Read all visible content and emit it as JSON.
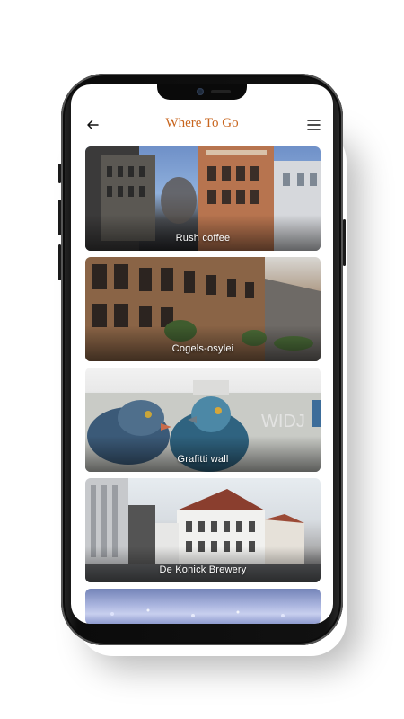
{
  "header": {
    "title": "Where To Go",
    "back_icon": "arrow-left-icon",
    "menu_icon": "hamburger-menu-icon"
  },
  "places": [
    {
      "name": "Rush coffee"
    },
    {
      "name": "Cogels-osylei"
    },
    {
      "name": "Grafitti wall"
    },
    {
      "name": "De Konick Brewery"
    },
    {
      "name": ""
    }
  ],
  "colors": {
    "accent": "#c8651e",
    "card_text": "#ffffff",
    "phone_frame": "#0b0b0b"
  }
}
